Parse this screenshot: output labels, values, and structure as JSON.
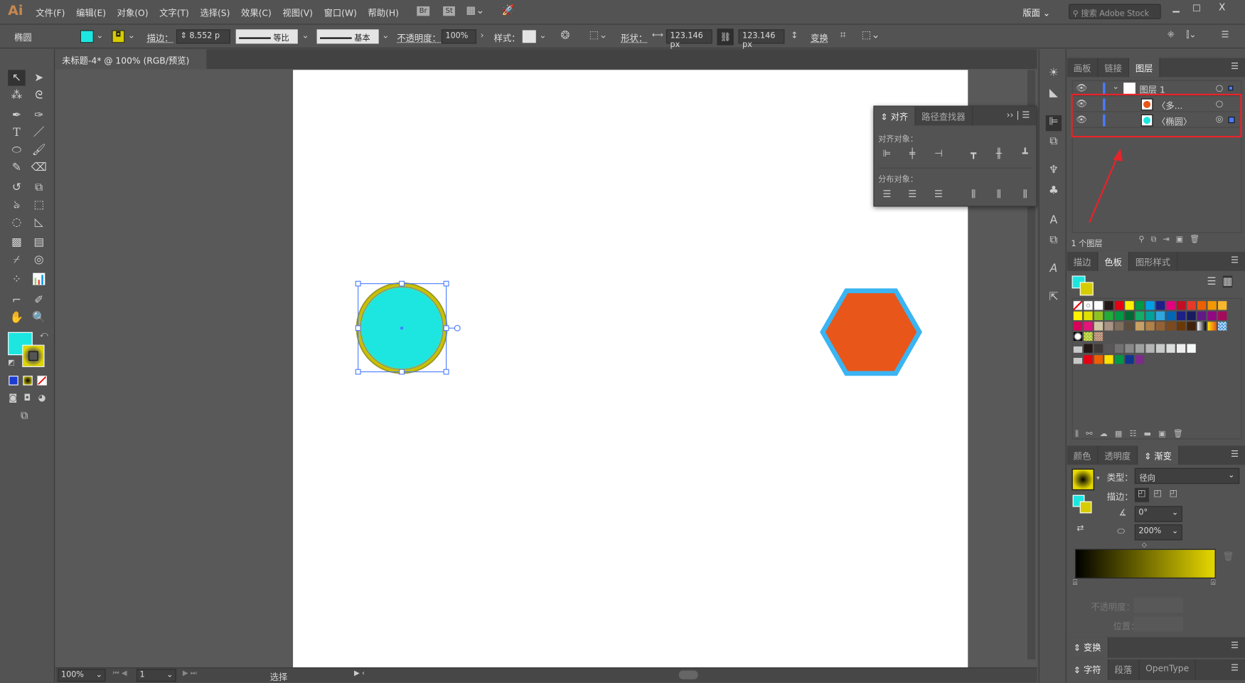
{
  "app": {
    "logo": "Ai",
    "menu": [
      "文件(F)",
      "编辑(E)",
      "对象(O)",
      "文字(T)",
      "选择(S)",
      "效果(C)",
      "视图(V)",
      "窗口(W)",
      "帮助(H)"
    ],
    "br": "Br",
    "st": "St",
    "workspace": "版面",
    "search_placeholder": "搜索 Adobe Stock"
  },
  "control": {
    "object_type": "椭圆",
    "fill_color": "#1de6e0",
    "stroke_label": "描边：",
    "stroke_weight": "8.552",
    "stroke_unit": "p",
    "profile": "等比",
    "brush": "基本",
    "opacity_label": "不透明度：",
    "opacity": "100%",
    "style_label": "样式：",
    "shape_label": "形状：",
    "width": "123.146 px",
    "height": "123.146 px",
    "transform_label": "变换"
  },
  "document": {
    "tab_title": "未标题-4* @ 100% (RGB/预览)",
    "close": "×"
  },
  "canvas": {
    "circle_fill": "#1de6e0",
    "circle_stroke": "#c8c000",
    "hexagon_fill": "#e8561a",
    "hexagon_stroke": "#3ab4f2"
  },
  "align_panel": {
    "tabs": [
      "对齐",
      "路径查找器"
    ],
    "align_objects": "对齐对象：",
    "distribute_objects": "分布对象："
  },
  "layers_panel": {
    "tabs": [
      "画板",
      "链接",
      "图层"
    ],
    "layer_name": "图层 1",
    "items": [
      "〈多...",
      "〈椭圆〉"
    ],
    "footer": "1 个图层",
    "highlight_color": "#e8232a"
  },
  "swatches_panel": {
    "tabs": [
      "描边",
      "色板",
      "图形样式"
    ],
    "rows": [
      [
        "none",
        "reg",
        "#ffffff",
        "#231815",
        "#e60012",
        "#fff100",
        "#009944",
        "#00a0e9",
        "#1d2088",
        "#e4007f",
        "#c30d23",
        "#e83828",
        "#eb6100",
        "#f39800",
        "#f8b62d"
      ],
      [
        "#fff100",
        "#dfe000",
        "#8fc31f",
        "#22ac38",
        "#009944",
        "#006934",
        "#13ae67",
        "#00a29a",
        "#2ea7e0",
        "#0068b7",
        "#1d2088",
        "#171c61",
        "#601986",
        "#920783",
        "#a40b5d"
      ],
      [
        "#d7005a",
        "#e4147c",
        "#d3c6a6",
        "#a99383",
        "#7f6f5c",
        "#5e4c3d",
        "#c8a063",
        "#b28146",
        "#956134",
        "#7c4a1e",
        "#6a3906",
        "#42210b",
        "grad1",
        "grad2",
        "grad3"
      ],
      [
        "pat1",
        "pat2",
        "pat3"
      ],
      [
        "folder",
        "#231815",
        "#3e3a39",
        "#595757",
        "#727171",
        "#898989",
        "#9fa0a0",
        "#b5b5b6",
        "#c9caca",
        "#dcdddd",
        "#efefef",
        "#f7f8f8"
      ],
      [
        "folder",
        "#e60012",
        "#eb6100",
        "#ffe100",
        "#009944",
        "#0f3591",
        "#7d2b8b"
      ]
    ]
  },
  "gradient_panel": {
    "tabs": [
      "颜色",
      "透明度",
      "渐变"
    ],
    "type_label": "类型：",
    "type_value": "径向",
    "stroke_label": "描边：",
    "angle": "0°",
    "aspect": "200%",
    "opacity_label": "不透明度：",
    "location_label": "位置：",
    "start_color": "#000000",
    "end_color": "#e6d800"
  },
  "transform_panel": {
    "title": "变换"
  },
  "character_panel": {
    "tabs": [
      "字符",
      "段落",
      "OpenType"
    ]
  },
  "status": {
    "zoom": "100%",
    "artboard": "1",
    "tool": "选择"
  }
}
